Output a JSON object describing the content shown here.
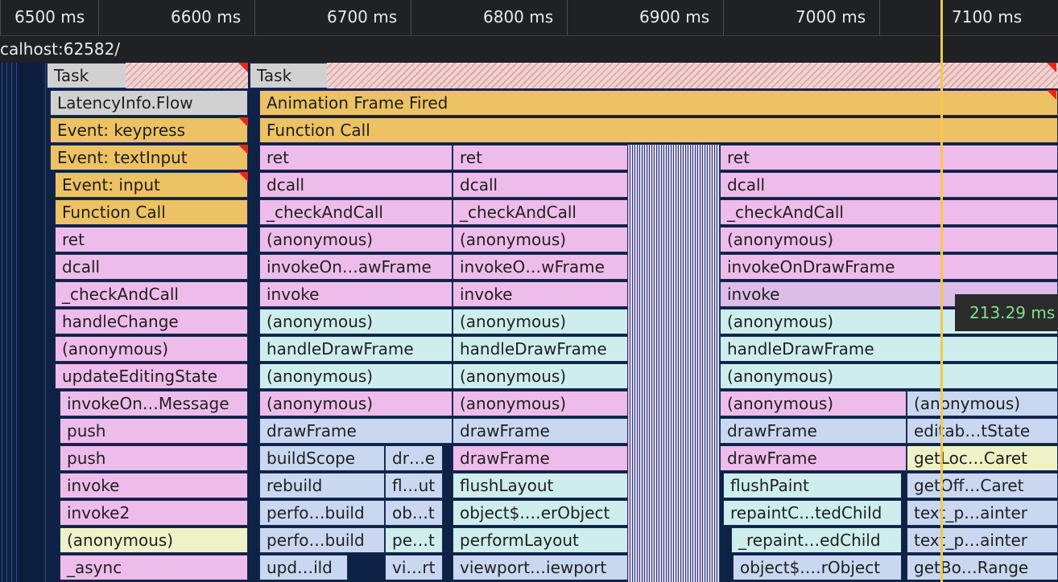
{
  "ruler": {
    "ticks": [
      "6500 ms",
      "6600 ms",
      "6700 ms",
      "6800 ms",
      "6900 ms",
      "7000 ms",
      "7100 ms"
    ]
  },
  "url_label": "calhost:62582/",
  "tooltip_duration": "213.29 ms",
  "colors": {
    "yellow": "#ecc264",
    "pink": "#eebcea",
    "teal": "#cdeeed",
    "blue": "#c9d8f0",
    "lime": "#eef2c6",
    "cursor": "#f5c84a",
    "tooltip_text": "#7ee08a"
  },
  "col1": {
    "task": "Task",
    "rows": [
      "LatencyInfo.Flow",
      "Event: keypress",
      "Event: textInput",
      "Event: input",
      "Function Call",
      "ret",
      "dcall",
      "_checkAndCall",
      "handleChange",
      "(anonymous)",
      "updateEditingState",
      "invokeOn…Message",
      "push",
      "push",
      "invoke",
      "invoke2",
      "(anonymous)",
      "_async"
    ]
  },
  "col2": {
    "task": "Task",
    "animation": "Animation Frame Fired",
    "function_call": "Function Call"
  },
  "colA": [
    "ret",
    "dcall",
    "_checkAndCall",
    "(anonymous)",
    "invokeOn…awFrame",
    "invoke",
    "(anonymous)",
    "handleDrawFrame",
    "(anonymous)",
    "(anonymous)",
    "drawFrame",
    "buildScope",
    "rebuild",
    "perfo…build",
    "perfo…build",
    "upd…ild"
  ],
  "colA2": [
    "dr…e",
    "fl…ut",
    "ob…t",
    "pe…t",
    "vi…rt"
  ],
  "colB": [
    "ret",
    "dcall",
    "_checkAndCall",
    "(anonymous)",
    "invokeO…wFrame",
    "invoke",
    "(anonymous)",
    "handleDrawFrame",
    "(anonymous)",
    "(anonymous)",
    "drawFrame",
    "drawFrame",
    "flushLayout",
    "object$.…erObject",
    "performLayout",
    "viewport…iewport"
  ],
  "colC": [
    "ret",
    "dcall",
    "_checkAndCall",
    "(anonymous)",
    "invokeOnDrawFrame",
    "invoke",
    "(anonymous)",
    "handleDrawFrame",
    "(anonymous)",
    "(anonymous)",
    "drawFrame",
    "drawFrame",
    "flushPaint",
    "repaintC…tedChild",
    "_repaint…edChild",
    "object$.…rObject"
  ],
  "colD": [
    "(anonymous)",
    "editab…tState",
    "getLoc…Caret",
    "getOff…Caret",
    "text_p…ainter",
    "text_p…ainter",
    "getBo…Range"
  ]
}
